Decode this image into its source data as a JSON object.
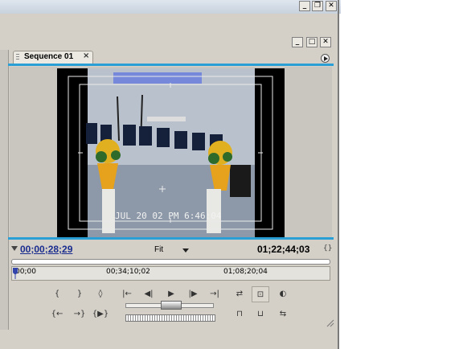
{
  "window": {
    "minimize_icon": "minimize-icon",
    "restore_icon": "restore-icon",
    "close_icon": "close-icon"
  },
  "panel": {
    "tab_label": "Sequence 01",
    "tab_close": "×"
  },
  "video": {
    "date_stamp": "JUL 20 02  PM 6:46:04"
  },
  "timecodes": {
    "current": "00;00;28;29",
    "duration": "01;22;44;03",
    "zoom": "Fit"
  },
  "ruler": {
    "labels": [
      "00;00",
      "00;34;10;02",
      "01;08;20;04"
    ]
  },
  "controls": {
    "row1_left": [
      "{",
      "}",
      "◊"
    ],
    "row2_left": [
      "{←",
      "→}",
      "{▶}"
    ],
    "row1_transport": [
      "|←",
      "◀|",
      "▶",
      "|▶",
      "→|"
    ],
    "row1_right": [
      "⇄",
      "⊡",
      "◐"
    ],
    "row2_right": [
      "⊓",
      "⊔",
      "⇆"
    ]
  },
  "colors": {
    "accent": "#2a9fd6",
    "timecode": "#1a2d8f",
    "panel_bg": "#d4d0c8"
  }
}
